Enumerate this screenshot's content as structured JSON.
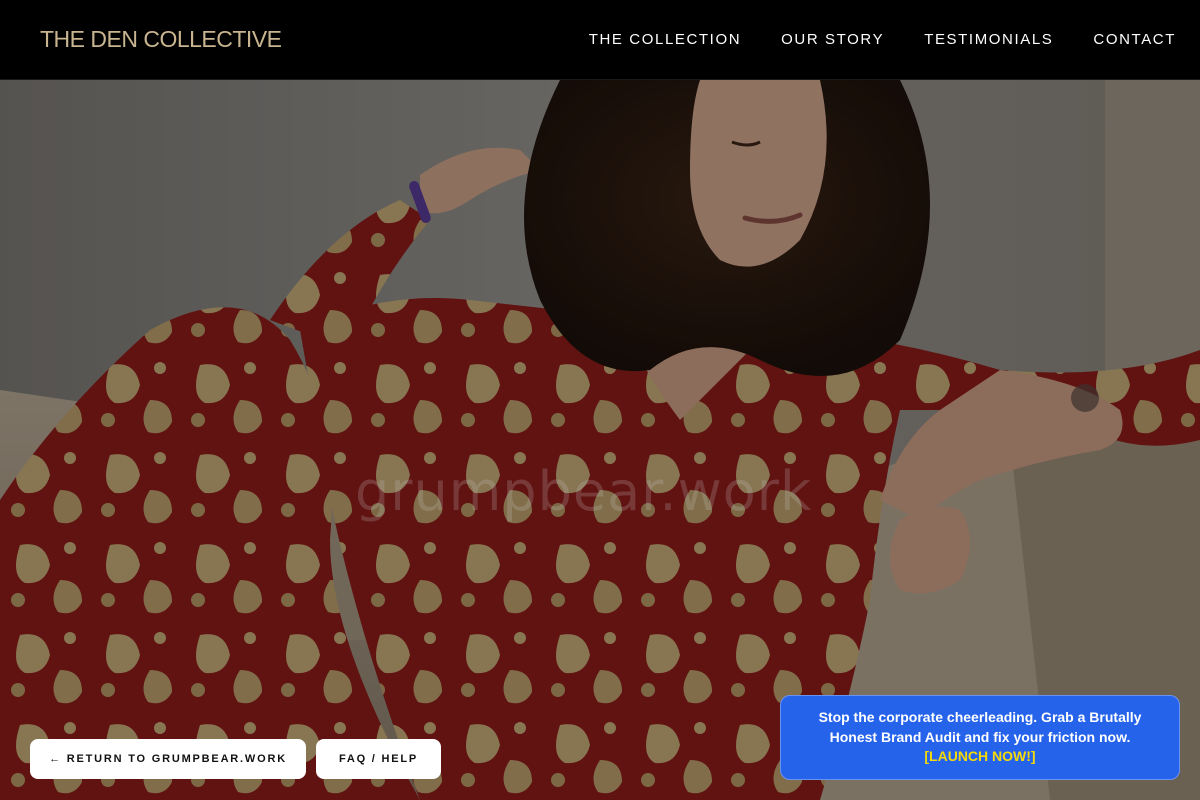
{
  "header": {
    "brand": "THE DEN COLLECTIVE",
    "nav": [
      {
        "label": "THE COLLECTION"
      },
      {
        "label": "OUR STORY"
      },
      {
        "label": "TESTIMONIALS"
      },
      {
        "label": "CONTACT"
      }
    ]
  },
  "hero": {
    "watermark": "grumpbear.work"
  },
  "actions": {
    "return_label": "← RETURN TO GRUMPBEAR.WORK",
    "faq_label": "FAQ / HELP"
  },
  "promo": {
    "text": "Stop the corporate cheerleading. Grab a Brutally Honest Brand Audit and fix your friction now.",
    "cta": "[LAUNCH NOW!]"
  },
  "colors": {
    "brand": "#c8b58f",
    "promo_bg": "#2563eb",
    "promo_cta": "#f5d90a"
  }
}
